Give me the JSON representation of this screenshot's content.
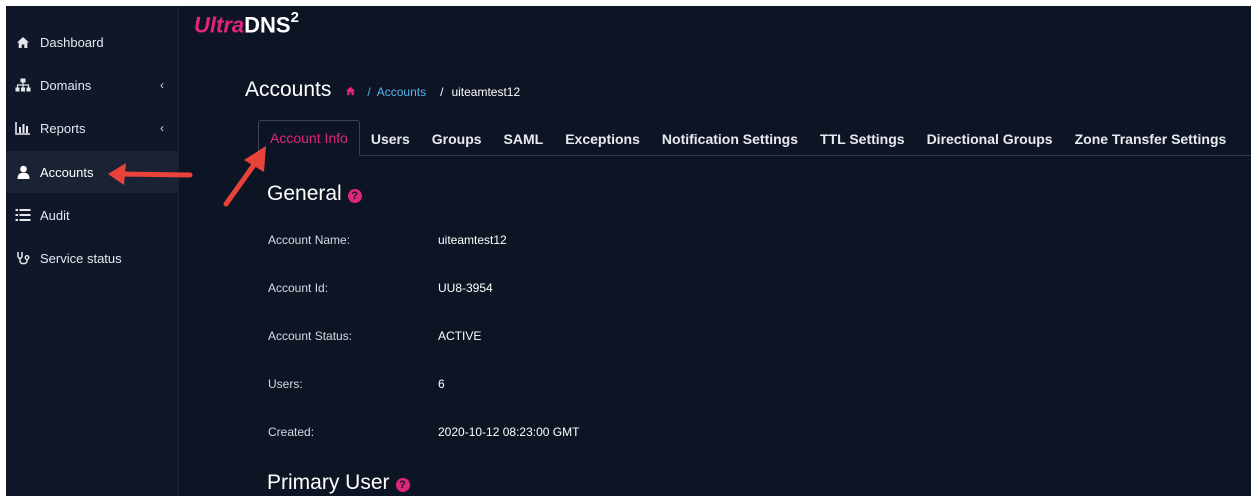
{
  "sidebar": {
    "items": [
      {
        "label": "Dashboard",
        "icon": "home-icon"
      },
      {
        "label": "Domains",
        "icon": "sitemap-icon",
        "chevron": "‹"
      },
      {
        "label": "Reports",
        "icon": "bar-chart-icon",
        "chevron": "‹"
      },
      {
        "label": "Accounts",
        "icon": "user-icon"
      },
      {
        "label": "Audit",
        "icon": "list-icon"
      },
      {
        "label": "Service status",
        "icon": "stethoscope-icon"
      }
    ]
  },
  "logo": {
    "ultra": "Ultra",
    "dns": "DNS",
    "sup": "2"
  },
  "page": {
    "title": "Accounts"
  },
  "breadcrumb": {
    "accounts": "Accounts",
    "current": "uiteamtest12",
    "sep": "/"
  },
  "tabs": [
    "Account Info",
    "Users",
    "Groups",
    "SAML",
    "Exceptions",
    "Notification Settings",
    "TTL Settings",
    "Directional Groups",
    "Zone Transfer Settings"
  ],
  "general": {
    "title": "General",
    "help": "?",
    "fields": [
      {
        "label": "Account Name:",
        "value": "uiteamtest12"
      },
      {
        "label": "Account Id:",
        "value": "UU8-3954"
      },
      {
        "label": "Account Status:",
        "value": "ACTIVE"
      },
      {
        "label": "Users:",
        "value": "6"
      },
      {
        "label": "Created:",
        "value": "2020-10-12 08:23:00 GMT"
      }
    ]
  },
  "primary_user": {
    "title": "Primary User",
    "help": "?"
  },
  "colors": {
    "accent": "#e0267a",
    "link": "#52b6ee",
    "background": "#0d1424",
    "arrow": "#e8423b"
  }
}
